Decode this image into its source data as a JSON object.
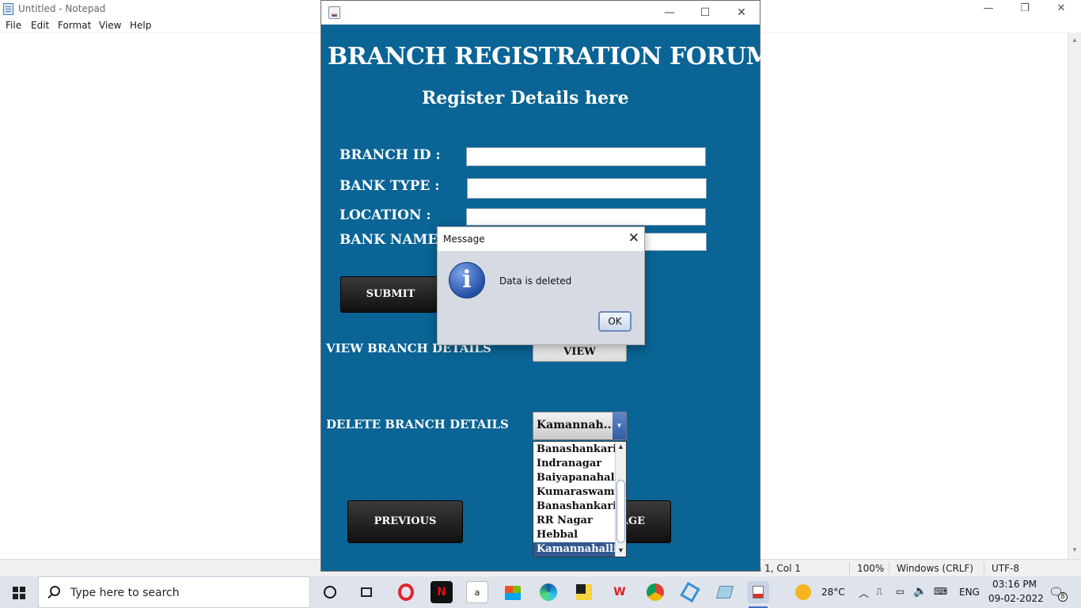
{
  "notepad": {
    "title": "Untitled - Notepad",
    "controls": {
      "minimize": "—",
      "restore": "❐",
      "close": "✕"
    },
    "menu": [
      "File",
      "Edit",
      "Format",
      "View",
      "Help"
    ],
    "status": {
      "position": "Ln 1, Col 1",
      "zoom": "100%",
      "line_ending": "Windows (CRLF)",
      "encoding": "UTF-8"
    }
  },
  "java_frame": {
    "controls": {
      "minimize": "—",
      "maximize": "☐",
      "close": "✕"
    },
    "heading": "BRANCH REGISTRATION FORUM",
    "subheading": "Register Details here",
    "fields": {
      "branch_id": {
        "label": "BRANCH ID :",
        "value": ""
      },
      "bank_type": {
        "label": "BANK TYPE :",
        "value": ""
      },
      "location": {
        "label": "LOCATION :",
        "value": ""
      },
      "bank_name": {
        "label": "BANK NAME",
        "value": ""
      }
    },
    "submit_label": "SUBMIT",
    "view_section_label": "VIEW BRANCH DETAILS",
    "view_button": "VIEW",
    "delete_section_label": "DELETE  BRANCH DETAILS",
    "combo_value": "Kamannah...",
    "dropdown_options": [
      "Banashankari",
      "Indranagar",
      "Baiyapanahalli",
      "Kumaraswamy",
      "Banashankari",
      "RR Nagar",
      "Hebbal",
      "Kamannahalli"
    ],
    "selected_index": 7,
    "previous_button": "PREVIOUS",
    "next_button_partial": "AGE"
  },
  "dialog": {
    "title": "Message",
    "close_glyph": "✕",
    "message": "Data is deleted",
    "ok_label": "OK",
    "icon": "info-icon"
  },
  "taskbar": {
    "search_placeholder": "Type here to search",
    "weather": "28°C",
    "language": "ENG",
    "time": "03:16 PM",
    "date": "09-02-2022",
    "notifications": "8",
    "apps": [
      "cortana-icon",
      "task-view-icon",
      "opera-icon",
      "netflix-icon",
      "amazon-icon",
      "store-icon",
      "edge-icon",
      "sticky-notes-icon",
      "wps-icon",
      "chrome-icon",
      "vscode-icon",
      "notepad-icon",
      "java-icon"
    ],
    "amazon_glyph": "a",
    "netflix_glyph": "N"
  },
  "colors": {
    "frame_blue": "#0a6495",
    "selection": "#33598f",
    "taskbar": "#dfe4ec"
  }
}
